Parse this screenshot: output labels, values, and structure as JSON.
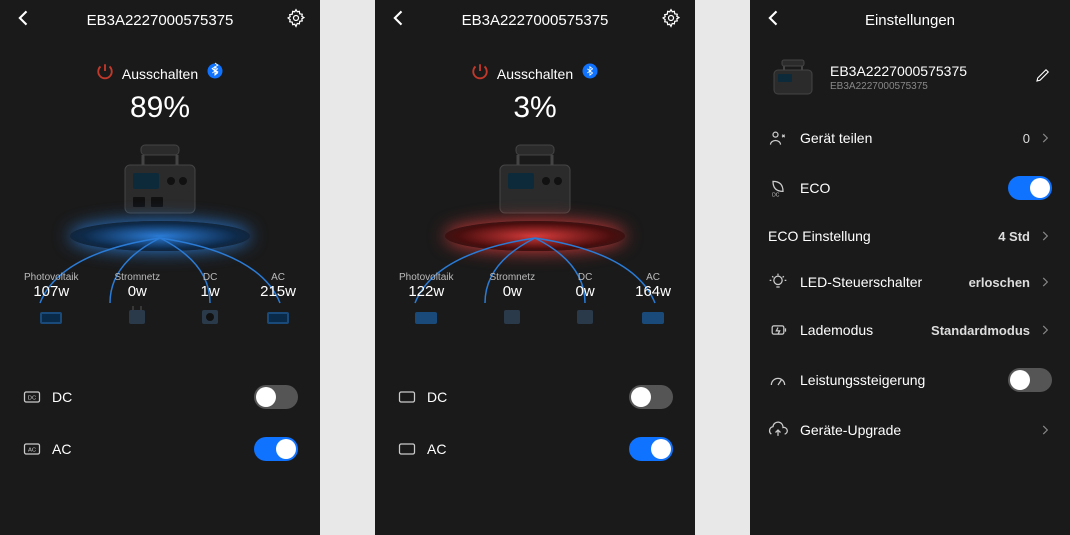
{
  "screens": [
    {
      "header": {
        "title": "EB3A2227000575375"
      },
      "powerStatus": "Ausschalten",
      "batteryPct": "89%",
      "platform": "blue",
      "loads": {
        "pv": {
          "label": "Photovoltaik",
          "value": "107w"
        },
        "grid": {
          "label": "Stromnetz",
          "value": "0w"
        },
        "dc": {
          "label": "DC",
          "value": "1w"
        },
        "ac": {
          "label": "AC",
          "value": "215w"
        }
      },
      "toggles": {
        "dc": {
          "label": "DC",
          "state": "off"
        },
        "ac": {
          "label": "AC",
          "state": "on"
        }
      }
    },
    {
      "header": {
        "title": "EB3A2227000575375"
      },
      "powerStatus": "Ausschalten",
      "batteryPct": "3%",
      "platform": "red",
      "loads": {
        "pv": {
          "label": "Photovoltaik",
          "value": "122w"
        },
        "grid": {
          "label": "Stromnetz",
          "value": "0w"
        },
        "dc": {
          "label": "DC",
          "value": "0w"
        },
        "ac": {
          "label": "AC",
          "value": "164w"
        }
      },
      "toggles": {
        "dc": {
          "label": "DC",
          "state": "off"
        },
        "ac": {
          "label": "AC",
          "state": "on"
        }
      }
    }
  ],
  "settings": {
    "header": "Einstellungen",
    "device": {
      "name": "EB3A2227000575375",
      "sub": "EB3A2227000575375"
    },
    "rows": {
      "share": {
        "label": "Gerät teilen",
        "value": "0"
      },
      "eco": {
        "label": "ECO",
        "toggle": "on"
      },
      "ecoSet": {
        "label": "ECO Einstellung",
        "value": "4 Std"
      },
      "led": {
        "label": "LED-Steuerschalter",
        "value": "erloschen"
      },
      "charge": {
        "label": "Lademodus",
        "value": "Standardmodus"
      },
      "boost": {
        "label": "Leistungssteigerung",
        "toggle": "off"
      },
      "upgrade": {
        "label": "Geräte-Upgrade"
      }
    }
  },
  "colors": {
    "accent": "#1073ff",
    "bg": "#1a1a1a",
    "danger": "#c0392b"
  }
}
